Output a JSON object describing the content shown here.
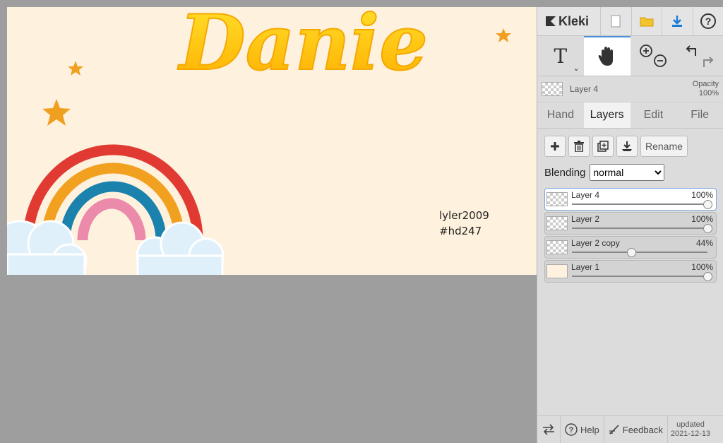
{
  "canvas": {
    "title_art": "Danie",
    "signature_line1": "lyler2009",
    "signature_line2": "#hd247"
  },
  "app": {
    "name": "Kleki"
  },
  "topbar": {
    "icons": [
      "new-file-icon",
      "open-folder-icon",
      "download-icon",
      "help-icon"
    ]
  },
  "tools": {
    "text_glyph": "T",
    "items": [
      "text-tool",
      "hand-tool",
      "zoom-tool",
      "undo-redo"
    ]
  },
  "current_layer": {
    "name": "Layer 4",
    "opacity_label": "Opacity",
    "opacity_value": "100%"
  },
  "tabs": [
    {
      "label": "Hand"
    },
    {
      "label": "Layers"
    },
    {
      "label": "Edit"
    },
    {
      "label": "File"
    }
  ],
  "layer_actions": {
    "rename_label": "Rename"
  },
  "blending": {
    "label": "Blending",
    "value": "normal"
  },
  "layers": [
    {
      "name": "Layer 4",
      "percent": "100%",
      "opacity": 1.0
    },
    {
      "name": "Layer 2",
      "percent": "100%",
      "opacity": 1.0
    },
    {
      "name": "Layer 2 copy",
      "percent": "44%",
      "opacity": 0.44
    },
    {
      "name": "Layer 1",
      "percent": "100%",
      "opacity": 1.0
    }
  ],
  "bottombar": {
    "help_label": "Help",
    "feedback_label": "Feedback",
    "updated_label": "updated",
    "updated_date": "2021-12-13"
  },
  "colors": {
    "accent": "#4a90d9",
    "canvas_bg": "#fef1dd",
    "workspace_bg": "#9e9e9e"
  }
}
